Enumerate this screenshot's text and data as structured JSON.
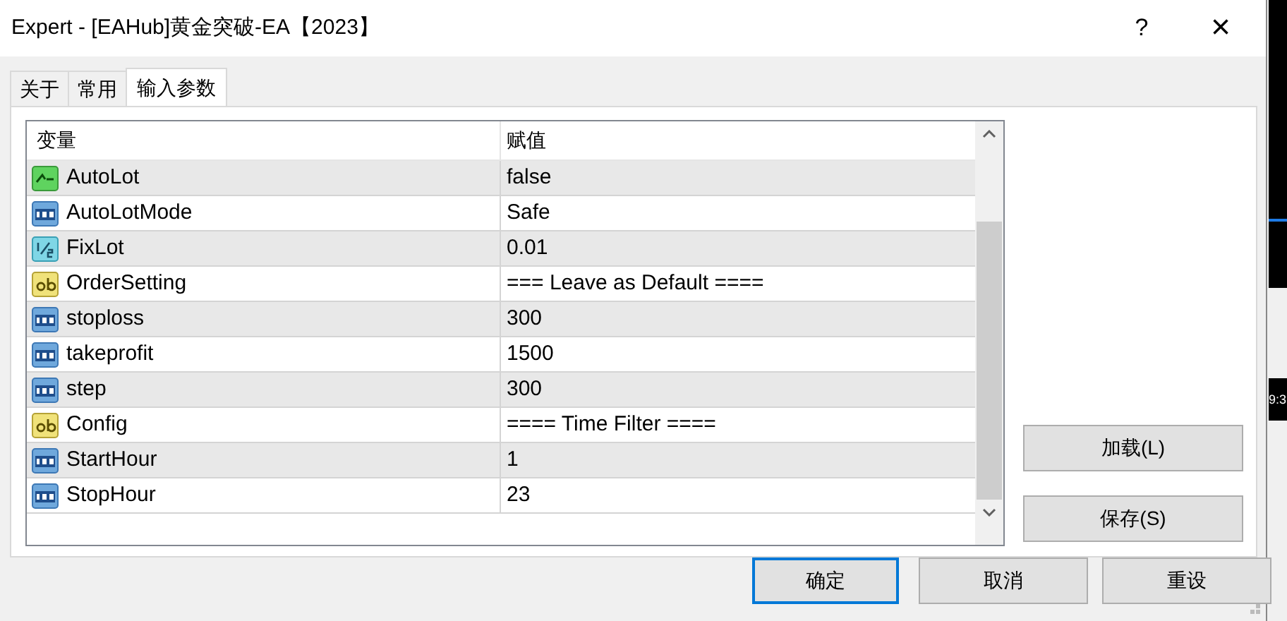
{
  "window": {
    "title": "Expert - [EAHub]黄金突破-EA【2023】",
    "help": "?",
    "close": "×"
  },
  "tabs": [
    {
      "label": "关于",
      "selected": false
    },
    {
      "label": "常用",
      "selected": false
    },
    {
      "label": "输入参数",
      "selected": true
    }
  ],
  "table": {
    "columns": [
      "变量",
      "赋值"
    ],
    "rows": [
      {
        "kind": "bool",
        "name": "AutoLot",
        "value": "false"
      },
      {
        "kind": "int",
        "name": "AutoLotMode",
        "value": "Safe"
      },
      {
        "kind": "double",
        "name": "FixLot",
        "value": "0.01"
      },
      {
        "kind": "string",
        "name": "OrderSetting",
        "value": "=== Leave as Default ===="
      },
      {
        "kind": "int",
        "name": "stoploss",
        "value": "300"
      },
      {
        "kind": "int",
        "name": "takeprofit",
        "value": "1500"
      },
      {
        "kind": "int",
        "name": "step",
        "value": "300"
      },
      {
        "kind": "string",
        "name": "Config",
        "value": "==== Time Filter ===="
      },
      {
        "kind": "int",
        "name": "StartHour",
        "value": "1"
      },
      {
        "kind": "int",
        "name": "StopHour",
        "value": "23"
      }
    ]
  },
  "side_buttons": [
    "加载(L)",
    "保存(S)"
  ],
  "buttons": [
    {
      "label": "确定",
      "default": true
    },
    {
      "label": "取消",
      "default": false
    },
    {
      "label": "重设",
      "default": false
    }
  ],
  "background_chart": {
    "time_label": "9:3"
  }
}
